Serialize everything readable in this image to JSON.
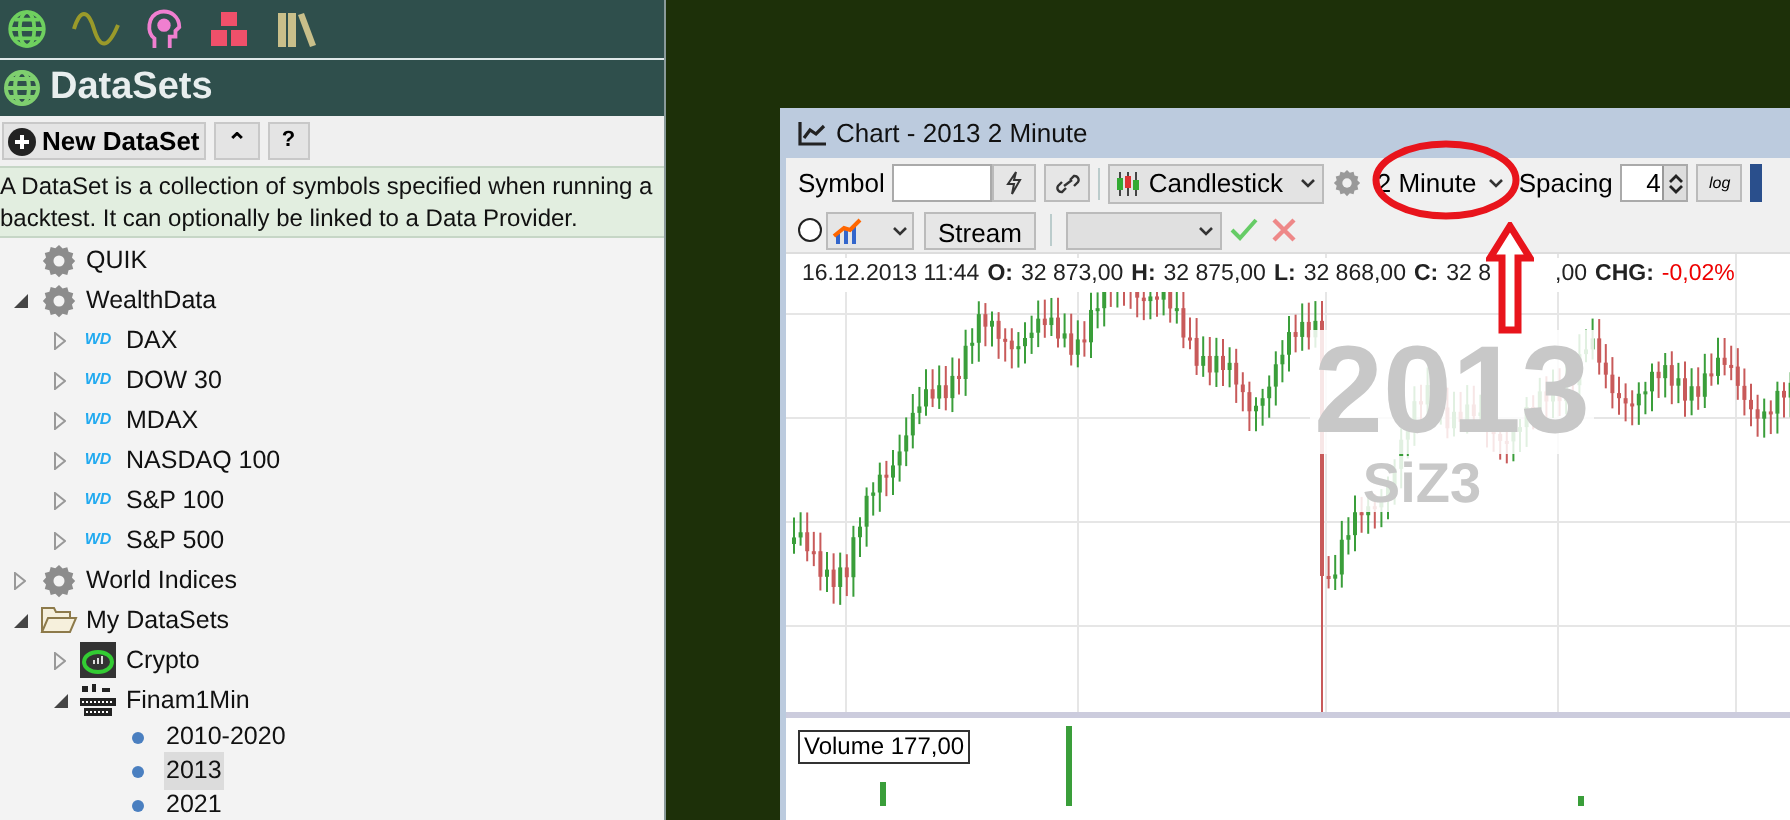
{
  "toolbar_icons": [
    {
      "kind": "globe"
    },
    {
      "kind": "wave"
    },
    {
      "kind": "head"
    },
    {
      "kind": "cubes"
    },
    {
      "kind": "books"
    }
  ],
  "panel": {
    "title": "DataSets",
    "new_button": "New DataSet",
    "collapse_button": "⌃",
    "help_button": "?",
    "description": "A DataSet is a collection of symbols specified when running a backtest. It can optionally be linked to a Data Provider."
  },
  "tree": [
    {
      "label": "QUIK",
      "kind": "gear",
      "selected": false
    },
    {
      "label": "WealthData",
      "kind": "gear",
      "expanded": true,
      "selected": false,
      "children": [
        {
          "label": "DAX",
          "kind": "wd",
          "logo": "WD",
          "expanded": false,
          "selected": false
        },
        {
          "label": "DOW 30",
          "kind": "wd",
          "logo": "WD",
          "expanded": false,
          "selected": false
        },
        {
          "label": "MDAX",
          "kind": "wd",
          "logo": "WD",
          "expanded": false,
          "selected": false
        },
        {
          "label": "NASDAQ 100",
          "kind": "wd",
          "logo": "WD",
          "expanded": false,
          "selected": false
        },
        {
          "label": "S&P 100",
          "kind": "wd",
          "logo": "WD",
          "expanded": false,
          "selected": false
        },
        {
          "label": "S&P 500",
          "kind": "wd",
          "logo": "WD",
          "expanded": false,
          "selected": false
        }
      ]
    },
    {
      "label": "World Indices",
      "kind": "gear",
      "expanded": false,
      "selected": false
    },
    {
      "label": "My DataSets",
      "kind": "folder",
      "expanded": true,
      "selected": false,
      "children": [
        {
          "label": "Crypto",
          "kind": "crypto",
          "expanded": false,
          "selected": false
        },
        {
          "label": "Finam1Min",
          "kind": "finam",
          "expanded": true,
          "selected": false,
          "children": [
            {
              "label": "2010-2020",
              "kind": "dot",
              "selected": false
            },
            {
              "label": "2013",
              "kind": "dot",
              "selected": true
            },
            {
              "label": "2021",
              "kind": "dot",
              "selected": false
            }
          ]
        }
      ]
    }
  ],
  "chart_window": {
    "title": "Chart - 2013 2 Minute",
    "symbol_label": "Symbol",
    "chart_type": "Candlestick",
    "scale": "2 Minute",
    "spacing_label": "Spacing",
    "spacing": "4",
    "log_button": "log",
    "stream_button": "Stream",
    "radio_selected": false,
    "info": {
      "date": "16.12.2013 11:44",
      "o_label": "O:",
      "o": "32 873,00",
      "h_label": "H:",
      "h": "32 875,00",
      "l_label": "L:",
      "l": "32 868,00",
      "c_label": "C:",
      "c_start": "32 8",
      "c_end": ",00",
      "chg_label": "CHG:",
      "chg": "-0,02%"
    },
    "watermark_year": "2013",
    "watermark_symbol": "SiZ3",
    "volume_label": "Volume 177,00"
  }
}
